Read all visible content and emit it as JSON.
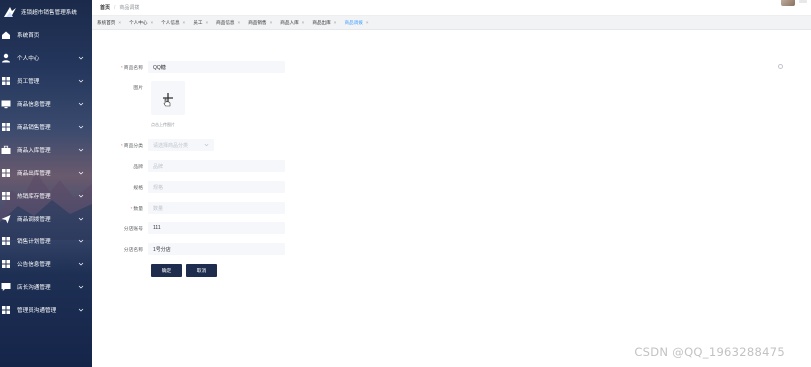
{
  "app": {
    "title": "连锁超市销售管理系统"
  },
  "sidebar": {
    "items": [
      {
        "label": "系统首页",
        "icon": "home-icon",
        "has_submenu": false
      },
      {
        "label": "个人中心",
        "icon": "user-icon",
        "has_submenu": true
      },
      {
        "label": "员工管理",
        "icon": "grid-icon",
        "has_submenu": true
      },
      {
        "label": "商品信息管理",
        "icon": "monitor-icon",
        "has_submenu": true
      },
      {
        "label": "商品销售管理",
        "icon": "grid-icon",
        "has_submenu": true
      },
      {
        "label": "商品入库管理",
        "icon": "briefcase-icon",
        "has_submenu": true
      },
      {
        "label": "商品出库管理",
        "icon": "grid-icon",
        "has_submenu": true
      },
      {
        "label": "热销库存管理",
        "icon": "grid-icon",
        "has_submenu": true
      },
      {
        "label": "商品调拨管理",
        "icon": "send-icon",
        "has_submenu": true
      },
      {
        "label": "销售计划管理",
        "icon": "grid-icon",
        "has_submenu": true
      },
      {
        "label": "公告信息管理",
        "icon": "grid-icon",
        "has_submenu": true
      },
      {
        "label": "店长沟通管理",
        "icon": "chat-icon",
        "has_submenu": true
      },
      {
        "label": "管理员沟通管理",
        "icon": "grid-icon",
        "has_submenu": true
      }
    ]
  },
  "header": {
    "breadcrumb": {
      "home": "首页",
      "current": "商品调拨"
    }
  },
  "tabs": [
    {
      "label": "系统首页",
      "active": false
    },
    {
      "label": "个人中心",
      "active": false
    },
    {
      "label": "个人信息",
      "active": false
    },
    {
      "label": "员工",
      "active": false
    },
    {
      "label": "商品信息",
      "active": false
    },
    {
      "label": "商品销售",
      "active": false
    },
    {
      "label": "商品入库",
      "active": false
    },
    {
      "label": "商品出库",
      "active": false
    },
    {
      "label": "商品调拨",
      "active": true
    }
  ],
  "tab_close": "×",
  "form": {
    "product_name": {
      "label": "商品名称",
      "required": true,
      "value": "QQ糖"
    },
    "image": {
      "label": "图片",
      "tip": "点击上传图片"
    },
    "category": {
      "label": "商品分类",
      "required": true,
      "placeholder": "请选择商品分类"
    },
    "brand": {
      "label": "品牌",
      "placeholder": "品牌"
    },
    "spec": {
      "label": "规格",
      "placeholder": "规格"
    },
    "quantity": {
      "label": "数量",
      "required": true,
      "placeholder": "数量"
    },
    "branch_account": {
      "label": "分店账号",
      "value": "111"
    },
    "branch_name": {
      "label": "分店名称",
      "value": "1号分店"
    },
    "confirm_label": "确定",
    "cancel_label": "取消"
  },
  "watermark": "CSDN @QQ_1963288475",
  "colors": {
    "sidebar_bg": "#1b2a4a",
    "button_bg": "#1e2d4e",
    "active_tab": "#409eff",
    "required": "#f56c6c"
  }
}
